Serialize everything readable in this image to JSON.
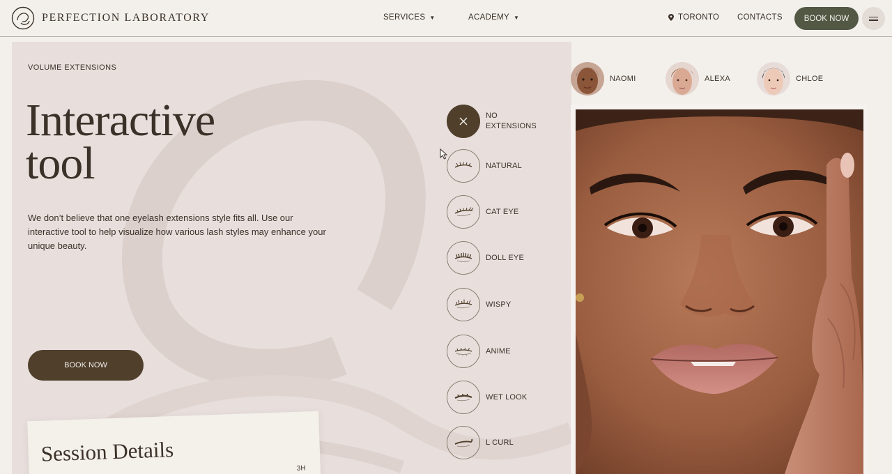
{
  "header": {
    "brand": "PERFECTION LABORATORY",
    "nav": [
      {
        "label": "SERVICES",
        "has_dropdown": true
      },
      {
        "label": "ACADEMY",
        "has_dropdown": true
      }
    ],
    "location": "TORONTO",
    "contacts": "CONTACTS",
    "book_label": "BOOK NOW"
  },
  "main": {
    "section_label": "VOLUME EXTENSIONS",
    "title_line1": "Interactive",
    "title_line2": "tool",
    "description": "We don’t believe that one eyelash extensions style fits all. Use our interactive tool to help visualize how various lash styles may enhance your unique beauty.",
    "book_label": "BOOK NOW",
    "session_title": "Session Details",
    "session_extra": "3H"
  },
  "lash_options": [
    {
      "label": "NO EXTENSIONS",
      "selected": true
    },
    {
      "label": "NATURAL",
      "selected": false
    },
    {
      "label": "CAT EYE",
      "selected": false
    },
    {
      "label": "DOLL EYE",
      "selected": false
    },
    {
      "label": "WISPY",
      "selected": false
    },
    {
      "label": "ANIME",
      "selected": false
    },
    {
      "label": "WET LOOK",
      "selected": false
    },
    {
      "label": "L CURL",
      "selected": false
    }
  ],
  "models": [
    {
      "name": "NAOMI"
    },
    {
      "name": "ALEXA"
    },
    {
      "name": "CHLOE"
    }
  ],
  "colors": {
    "page_bg": "#f3f0ec",
    "panel_bg": "#e8dfdd",
    "dark_brown": "#4f3f2b",
    "olive_button": "#525844",
    "text": "#3b3128"
  },
  "icons": {
    "logo": "perfection-laboratory-logo",
    "location": "location-pin-icon",
    "menu": "hamburger-menu-icon",
    "selected_option": "close-x-icon"
  }
}
